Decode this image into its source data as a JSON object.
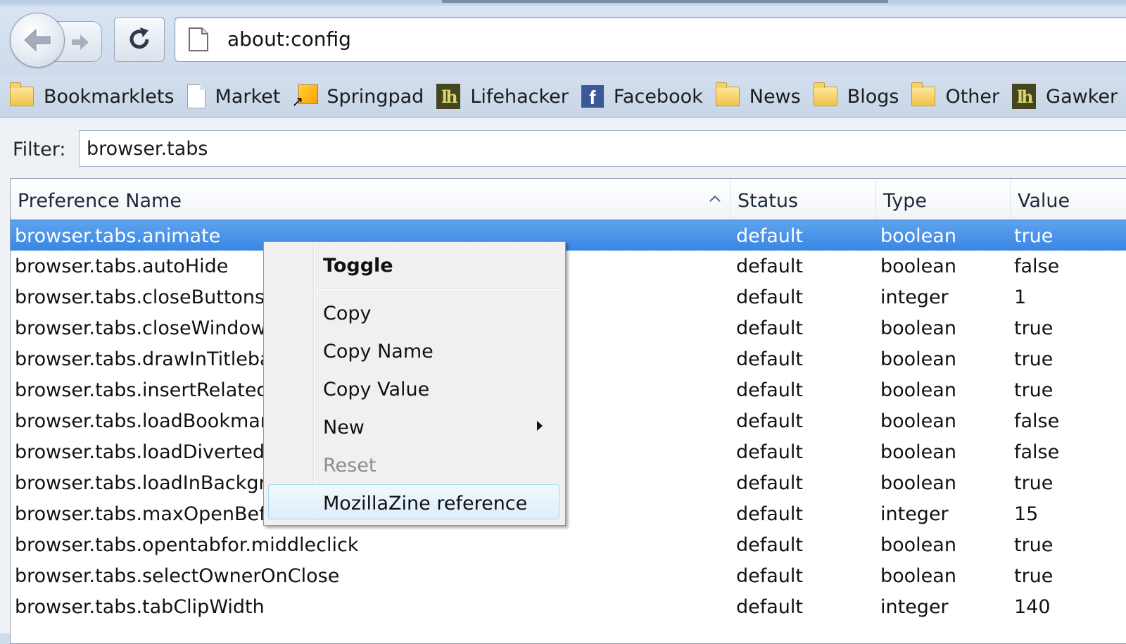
{
  "toolbar": {
    "back_icon": "back-arrow-icon",
    "forward_icon": "forward-arrow-icon",
    "reload_icon": "reload-icon"
  },
  "urlbar": {
    "url": "about:config",
    "icon": "page-icon"
  },
  "bookmarks": [
    {
      "label": "Bookmarklets",
      "icon": "folder-icon"
    },
    {
      "label": "Market",
      "icon": "page-icon"
    },
    {
      "label": "Springpad",
      "icon": "springpad-icon"
    },
    {
      "label": "Lifehacker",
      "icon": "lifehacker-icon"
    },
    {
      "label": "Facebook",
      "icon": "facebook-icon"
    },
    {
      "label": "News",
      "icon": "folder-icon"
    },
    {
      "label": "Blogs",
      "icon": "folder-icon"
    },
    {
      "label": "Other",
      "icon": "folder-icon"
    },
    {
      "label": "Gawker",
      "icon": "lifehacker-icon"
    }
  ],
  "filter": {
    "label": "Filter:",
    "value": "browser.tabs"
  },
  "columns": {
    "name": "Preference Name",
    "status": "Status",
    "type": "Type",
    "value": "Value"
  },
  "rows": [
    {
      "name": "browser.tabs.animate",
      "status": "default",
      "type": "boolean",
      "value": "true"
    },
    {
      "name": "browser.tabs.autoHide",
      "status": "default",
      "type": "boolean",
      "value": "false"
    },
    {
      "name": "browser.tabs.closeButtons",
      "status": "default",
      "type": "integer",
      "value": "1"
    },
    {
      "name": "browser.tabs.closeWindowW",
      "status": "default",
      "type": "boolean",
      "value": "true"
    },
    {
      "name": "browser.tabs.drawInTitlebar",
      "status": "default",
      "type": "boolean",
      "value": "true"
    },
    {
      "name": "browser.tabs.insertRelatedA",
      "status": "default",
      "type": "boolean",
      "value": "true"
    },
    {
      "name": "browser.tabs.loadBookmark",
      "status": "default",
      "type": "boolean",
      "value": "false"
    },
    {
      "name": "browser.tabs.loadDivertedIn",
      "status": "default",
      "type": "boolean",
      "value": "false"
    },
    {
      "name": "browser.tabs.loadInBackgro",
      "status": "default",
      "type": "boolean",
      "value": "true"
    },
    {
      "name": "browser.tabs.maxOpenBefo",
      "status": "default",
      "type": "integer",
      "value": "15"
    },
    {
      "name": "browser.tabs.opentabfor.middleclick",
      "status": "default",
      "type": "boolean",
      "value": "true"
    },
    {
      "name": "browser.tabs.selectOwnerOnClose",
      "status": "default",
      "type": "boolean",
      "value": "true"
    },
    {
      "name": "browser.tabs.tabClipWidth",
      "status": "default",
      "type": "integer",
      "value": "140"
    }
  ],
  "context_menu": {
    "toggle": "Toggle",
    "copy": "Copy",
    "copy_name": "Copy Name",
    "copy_value": "Copy Value",
    "new": "New",
    "reset": "Reset",
    "mozillazine": "MozillaZine reference"
  },
  "colors": {
    "selection": "#3a87e3",
    "chrome": "#cfdcec",
    "menu_hover": "#dcedfb"
  }
}
